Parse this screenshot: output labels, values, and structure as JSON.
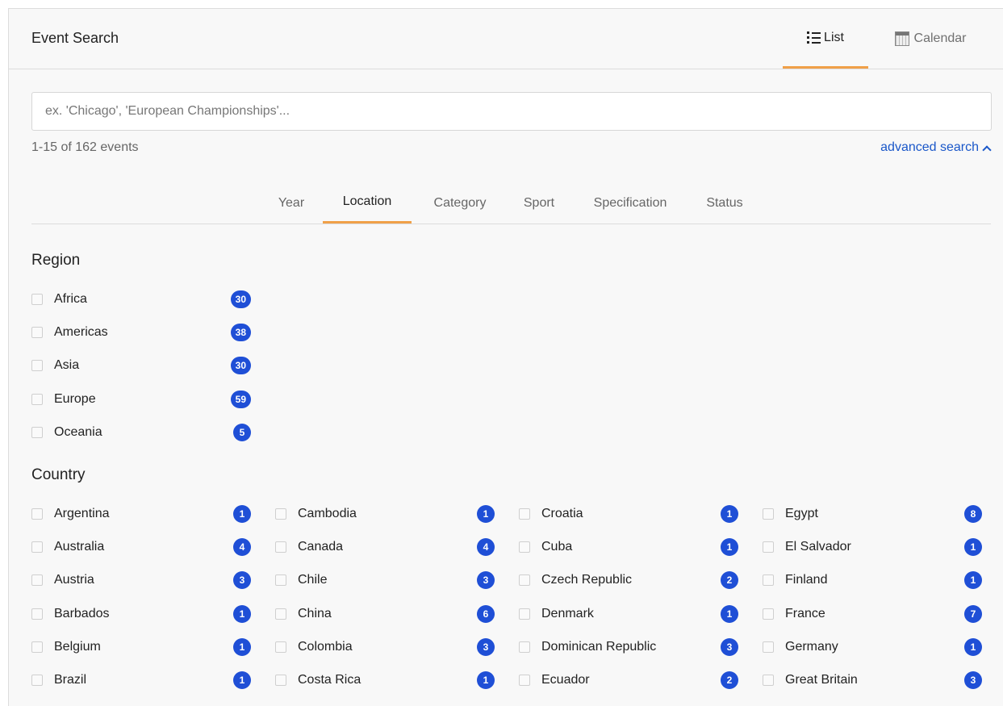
{
  "header": {
    "title": "Event Search",
    "views": [
      {
        "label": "List",
        "icon": "list-icon",
        "active": true
      },
      {
        "label": "Calendar",
        "icon": "calendar-icon",
        "active": false
      }
    ]
  },
  "search": {
    "placeholder": "ex. 'Chicago', 'European Championships'...",
    "value": ""
  },
  "results": {
    "count_text": "1-15 of 162 events",
    "advanced_label": "advanced search"
  },
  "filter_tabs": [
    {
      "label": "Year",
      "active": false
    },
    {
      "label": "Location",
      "active": true
    },
    {
      "label": "Category",
      "active": false
    },
    {
      "label": "Sport",
      "active": false
    },
    {
      "label": "Specification",
      "active": false
    },
    {
      "label": "Status",
      "active": false
    }
  ],
  "regions": {
    "title": "Region",
    "items": [
      {
        "label": "Africa",
        "count": "30"
      },
      {
        "label": "Americas",
        "count": "38"
      },
      {
        "label": "Asia",
        "count": "30"
      },
      {
        "label": "Europe",
        "count": "59"
      },
      {
        "label": "Oceania",
        "count": "5"
      }
    ]
  },
  "countries": {
    "title": "Country",
    "items": [
      {
        "label": "Argentina",
        "count": "1"
      },
      {
        "label": "Australia",
        "count": "4"
      },
      {
        "label": "Austria",
        "count": "3"
      },
      {
        "label": "Barbados",
        "count": "1"
      },
      {
        "label": "Belgium",
        "count": "1"
      },
      {
        "label": "Brazil",
        "count": "1"
      },
      {
        "label": "Cambodia",
        "count": "1"
      },
      {
        "label": "Canada",
        "count": "4"
      },
      {
        "label": "Chile",
        "count": "3"
      },
      {
        "label": "China",
        "count": "6"
      },
      {
        "label": "Colombia",
        "count": "3"
      },
      {
        "label": "Costa Rica",
        "count": "1"
      },
      {
        "label": "Croatia",
        "count": "1"
      },
      {
        "label": "Cuba",
        "count": "1"
      },
      {
        "label": "Czech Republic",
        "count": "2"
      },
      {
        "label": "Denmark",
        "count": "1"
      },
      {
        "label": "Dominican Republic",
        "count": "3"
      },
      {
        "label": "Ecuador",
        "count": "2"
      },
      {
        "label": "Egypt",
        "count": "8"
      },
      {
        "label": "El Salvador",
        "count": "1"
      },
      {
        "label": "Finland",
        "count": "1"
      },
      {
        "label": "France",
        "count": "7"
      },
      {
        "label": "Germany",
        "count": "1"
      },
      {
        "label": "Great Britain",
        "count": "3"
      }
    ]
  },
  "colors": {
    "accent": "#f0a048",
    "badge": "#1f4fd6",
    "link": "#1a57c9",
    "panel_bg": "#f8f8f8"
  }
}
